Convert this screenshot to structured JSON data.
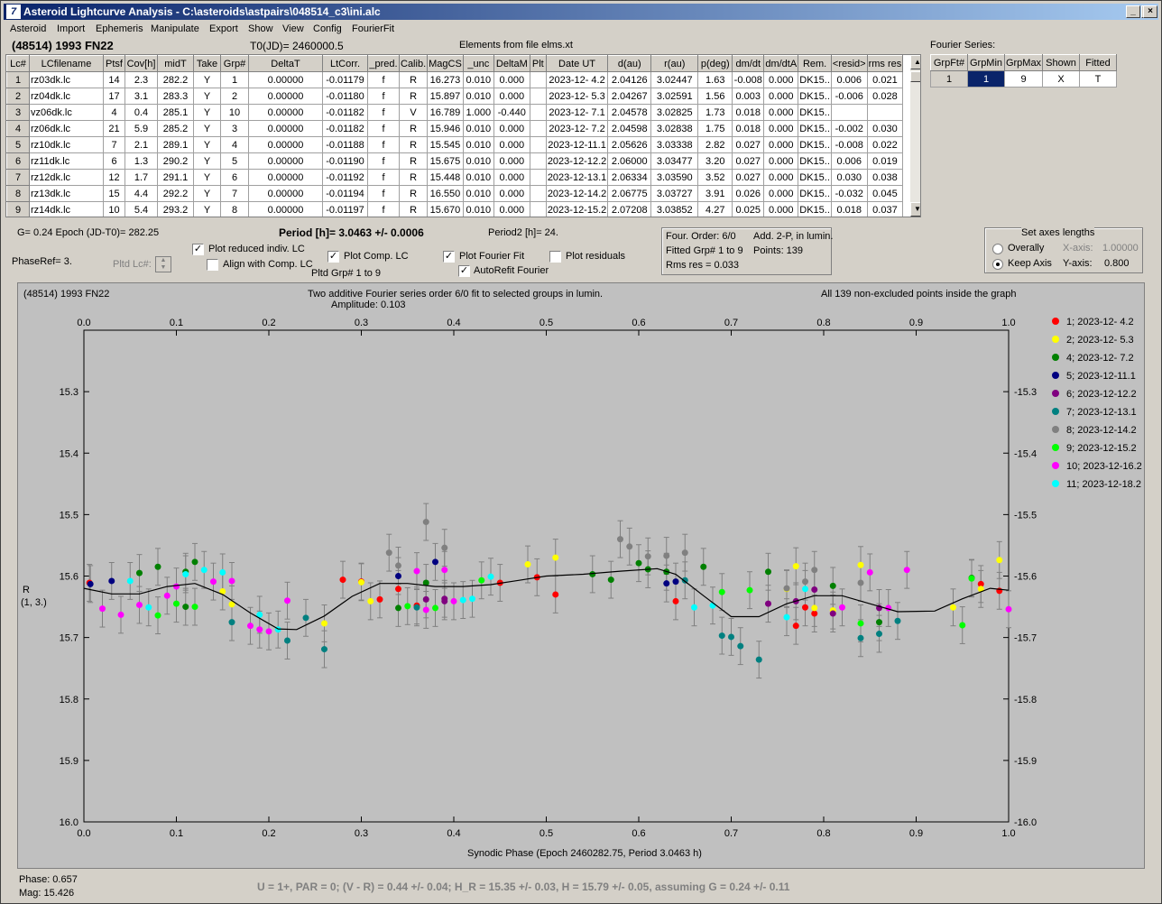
{
  "window": {
    "title": "Asteroid Lightcurve Analysis - C:\\asteroids\\astpairs\\048514_c3\\ini.alc",
    "icon_label": "7"
  },
  "menu": [
    "Asteroid",
    "Import",
    "Ephemeris",
    "Manipulate",
    "Export",
    "Show",
    "View",
    "Config",
    "FourierFit"
  ],
  "header": {
    "object": "(48514) 1993 FN22",
    "t0": "T0(JD)= 2460000.5",
    "elements": "Elements from file elms.xt",
    "fourier_title": "Fourier Series:"
  },
  "table": {
    "columns": [
      "Lc#",
      "LCfilename",
      "Ptsf",
      "Cov[h]",
      "midT",
      "Take",
      "Grp#",
      "DeltaT",
      "LtCorr.",
      "_pred.",
      "Calib.",
      "MagCS",
      "_unc",
      "DeltaM",
      "Plt",
      "Date UT",
      "d(au)",
      "r(au)",
      "p(deg)",
      "dm/dt",
      "dm/dtA",
      "Rem.",
      "<resid>",
      "rms res"
    ],
    "rows": [
      [
        "1",
        "rz03dk.lc",
        "14",
        "2.3",
        "282.2",
        "Y",
        "1",
        "0.00000",
        "-0.01179",
        "f",
        "R",
        "16.273",
        "0.010",
        "0.000",
        "",
        "2023-12- 4.2",
        "2.04126",
        "3.02447",
        "1.63",
        "-0.008",
        "0.000",
        "DK15..",
        "0.006",
        "0.021"
      ],
      [
        "2",
        "rz04dk.lc",
        "17",
        "3.1",
        "283.3",
        "Y",
        "2",
        "0.00000",
        "-0.01180",
        "f",
        "R",
        "15.897",
        "0.010",
        "0.000",
        "",
        "2023-12- 5.3",
        "2.04267",
        "3.02591",
        "1.56",
        "0.003",
        "0.000",
        "DK15..",
        "-0.006",
        "0.028"
      ],
      [
        "3",
        "vz06dk.lc",
        "4",
        "0.4",
        "285.1",
        "Y",
        "10",
        "0.00000",
        "-0.01182",
        "f",
        "V",
        "16.789",
        "1.000",
        "-0.440",
        "",
        "2023-12- 7.1",
        "2.04578",
        "3.02825",
        "1.73",
        "0.018",
        "0.000",
        "DK15..",
        "",
        ""
      ],
      [
        "4",
        "rz06dk.lc",
        "21",
        "5.9",
        "285.2",
        "Y",
        "3",
        "0.00000",
        "-0.01182",
        "f",
        "R",
        "15.946",
        "0.010",
        "0.000",
        "",
        "2023-12- 7.2",
        "2.04598",
        "3.02838",
        "1.75",
        "0.018",
        "0.000",
        "DK15..",
        "-0.002",
        "0.030"
      ],
      [
        "5",
        "rz10dk.lc",
        "7",
        "2.1",
        "289.1",
        "Y",
        "4",
        "0.00000",
        "-0.01188",
        "f",
        "R",
        "15.545",
        "0.010",
        "0.000",
        "",
        "2023-12-11.1",
        "2.05626",
        "3.03338",
        "2.82",
        "0.027",
        "0.000",
        "DK15..",
        "-0.008",
        "0.022"
      ],
      [
        "6",
        "rz11dk.lc",
        "6",
        "1.3",
        "290.2",
        "Y",
        "5",
        "0.00000",
        "-0.01190",
        "f",
        "R",
        "15.675",
        "0.010",
        "0.000",
        "",
        "2023-12-12.2",
        "2.06000",
        "3.03477",
        "3.20",
        "0.027",
        "0.000",
        "DK15..",
        "0.006",
        "0.019"
      ],
      [
        "7",
        "rz12dk.lc",
        "12",
        "1.7",
        "291.1",
        "Y",
        "6",
        "0.00000",
        "-0.01192",
        "f",
        "R",
        "15.448",
        "0.010",
        "0.000",
        "",
        "2023-12-13.1",
        "2.06334",
        "3.03590",
        "3.52",
        "0.027",
        "0.000",
        "DK15..",
        "0.030",
        "0.038"
      ],
      [
        "8",
        "rz13dk.lc",
        "15",
        "4.4",
        "292.2",
        "Y",
        "7",
        "0.00000",
        "-0.01194",
        "f",
        "R",
        "16.550",
        "0.010",
        "0.000",
        "",
        "2023-12-14.2",
        "2.06775",
        "3.03727",
        "3.91",
        "0.026",
        "0.000",
        "DK15..",
        "-0.032",
        "0.045"
      ],
      [
        "9",
        "rz14dk.lc",
        "10",
        "5.4",
        "293.2",
        "Y",
        "8",
        "0.00000",
        "-0.01197",
        "f",
        "R",
        "15.670",
        "0.010",
        "0.000",
        "",
        "2023-12-15.2",
        "2.07208",
        "3.03852",
        "4.27",
        "0.025",
        "0.000",
        "DK15..",
        "0.018",
        "0.037"
      ]
    ]
  },
  "fourier_table": {
    "columns": [
      "GrpFt#",
      "GrpMin",
      "GrpMax",
      "Shown",
      "Fitted"
    ],
    "row": [
      "1",
      "1",
      "9",
      "X",
      "T"
    ]
  },
  "controls": {
    "g_epoch": "G= 0.24   Epoch (JD-T0)= 282.25",
    "period": "Period [h]= 3.0463 +/- 0.0006",
    "period2": "Period2 [h]= 24.",
    "phaseref": "PhaseRef= 3.",
    "pltd_lc": "Pltd Lc#:",
    "plot_reduced": "Plot reduced indiv. LC",
    "align_comp": "Align with Comp. LC",
    "plot_comp": "Plot Comp. LC",
    "pltd_grp": "Pltd Grp#  1   to   9",
    "plot_fourier": "Plot Fourier Fit",
    "autorefit": "AutoRefit Fourier",
    "plot_residuals": "Plot residuals",
    "four_order": "Four. Order:  6/0",
    "add2p": "Add. 2-P, in lumin.",
    "fitted_grp": "Fitted Grp# 1 to 9",
    "points": "Points: 139",
    "rms": "Rms res     = 0.033",
    "axes_title": "Set axes lengths",
    "overally": "Overally",
    "keep_axis": "Keep Axis",
    "xaxis_lbl": "X-axis:",
    "xaxis_val": "1.00000",
    "yaxis_lbl": "Y-axis:",
    "yaxis_val": "0.800"
  },
  "plot": {
    "name": "(48514) 1993 FN22",
    "subtitle1": "Two additive Fourier series order 6/0 fit to selected groups in lumin.",
    "subtitle2": "Amplitude: 0.103",
    "note": "All 139 non-excluded points inside the graph",
    "ylabel1": "R",
    "ylabel2": "(1, 3.)"
  },
  "chart_data": {
    "type": "scatter",
    "xlabel": "Synodic Phase (Epoch 2460282.75, Period 3.0463 h)",
    "ylabel": "R (1, 3.)",
    "xlim": [
      0,
      1
    ],
    "ylim": [
      16.0,
      15.2
    ],
    "xticks": [
      "0.0",
      "0.1",
      "0.2",
      "0.3",
      "0.4",
      "0.5",
      "0.6",
      "0.7",
      "0.8",
      "0.9",
      "1.0"
    ],
    "yticks": [
      "15.3",
      "15.4",
      "15.5",
      "15.6",
      "15.7",
      "15.8",
      "15.9",
      "16.0"
    ],
    "fit_curve": [
      [
        0.0,
        15.62
      ],
      [
        0.03,
        15.629
      ],
      [
        0.06,
        15.629
      ],
      [
        0.09,
        15.617
      ],
      [
        0.12,
        15.612
      ],
      [
        0.15,
        15.63
      ],
      [
        0.18,
        15.66
      ],
      [
        0.21,
        15.686
      ],
      [
        0.23,
        15.687
      ],
      [
        0.26,
        15.665
      ],
      [
        0.29,
        15.633
      ],
      [
        0.32,
        15.612
      ],
      [
        0.35,
        15.612
      ],
      [
        0.38,
        15.617
      ],
      [
        0.41,
        15.617
      ],
      [
        0.44,
        15.614
      ],
      [
        0.47,
        15.607
      ],
      [
        0.5,
        15.6
      ],
      [
        0.54,
        15.597
      ],
      [
        0.58,
        15.592
      ],
      [
        0.62,
        15.588
      ],
      [
        0.64,
        15.597
      ],
      [
        0.67,
        15.632
      ],
      [
        0.7,
        15.666
      ],
      [
        0.73,
        15.666
      ],
      [
        0.76,
        15.645
      ],
      [
        0.79,
        15.632
      ],
      [
        0.82,
        15.632
      ],
      [
        0.85,
        15.645
      ],
      [
        0.88,
        15.658
      ],
      [
        0.92,
        15.657
      ],
      [
        0.95,
        15.637
      ],
      [
        0.98,
        15.62
      ],
      [
        1.0,
        15.623
      ]
    ],
    "series": [
      {
        "name": "1; 2023-12- 4.2",
        "color": "#ff0000",
        "points": [
          [
            0.006,
            15.611
          ],
          [
            0.28,
            15.606
          ],
          [
            0.3,
            15.609
          ],
          [
            0.32,
            15.638
          ],
          [
            0.34,
            15.621
          ],
          [
            0.36,
            15.648
          ],
          [
            0.45,
            15.611
          ],
          [
            0.49,
            15.602
          ],
          [
            0.51,
            15.63
          ],
          [
            0.64,
            15.641
          ],
          [
            0.77,
            15.681
          ],
          [
            0.78,
            15.651
          ],
          [
            0.79,
            15.661
          ],
          [
            0.97,
            15.613
          ],
          [
            0.99,
            15.624
          ]
        ]
      },
      {
        "name": "2; 2023-12- 5.3",
        "color": "#ffff00",
        "points": [
          [
            0.15,
            15.625
          ],
          [
            0.16,
            15.646
          ],
          [
            0.26,
            15.677
          ],
          [
            0.3,
            15.61
          ],
          [
            0.31,
            15.641
          ],
          [
            0.48,
            15.581
          ],
          [
            0.51,
            15.57
          ],
          [
            0.76,
            15.621
          ],
          [
            0.77,
            15.584
          ],
          [
            0.79,
            15.652
          ],
          [
            0.81,
            15.656
          ],
          [
            0.84,
            15.582
          ],
          [
            0.94,
            15.651
          ],
          [
            0.97,
            15.621
          ],
          [
            0.99,
            15.574
          ]
        ]
      },
      {
        "name": "4; 2023-12- 7.2",
        "color": "#008000",
        "points": [
          [
            0.06,
            15.595
          ],
          [
            0.08,
            15.585
          ],
          [
            0.11,
            15.593
          ],
          [
            0.12,
            15.577
          ],
          [
            0.11,
            15.65
          ],
          [
            0.34,
            15.652
          ],
          [
            0.37,
            15.611
          ],
          [
            0.55,
            15.597
          ],
          [
            0.57,
            15.606
          ],
          [
            0.6,
            15.579
          ],
          [
            0.61,
            15.589
          ],
          [
            0.63,
            15.593
          ],
          [
            0.67,
            15.585
          ],
          [
            0.74,
            15.593
          ],
          [
            0.81,
            15.616
          ],
          [
            0.86,
            15.675
          ],
          [
            0.96,
            15.603
          ]
        ]
      },
      {
        "name": "5; 2023-12-11.1",
        "color": "#000080",
        "points": [
          [
            0.007,
            15.613
          ],
          [
            0.03,
            15.608
          ],
          [
            0.34,
            15.6
          ],
          [
            0.38,
            15.577
          ],
          [
            0.63,
            15.612
          ],
          [
            0.64,
            15.609
          ]
        ]
      },
      {
        "name": "6; 2023-12-12.2",
        "color": "#800080",
        "points": [
          [
            0.37,
            15.638
          ],
          [
            0.39,
            15.637
          ],
          [
            0.39,
            15.641
          ],
          [
            0.74,
            15.645
          ],
          [
            0.77,
            15.641
          ],
          [
            0.79,
            15.622
          ],
          [
            0.81,
            15.661
          ],
          [
            0.86,
            15.652
          ]
        ]
      },
      {
        "name": "7; 2023-12-13.1",
        "color": "#008080",
        "points": [
          [
            0.16,
            15.675
          ],
          [
            0.22,
            15.705
          ],
          [
            0.24,
            15.668
          ],
          [
            0.26,
            15.719
          ],
          [
            0.36,
            15.651
          ],
          [
            0.65,
            15.607
          ],
          [
            0.69,
            15.697
          ],
          [
            0.7,
            15.699
          ],
          [
            0.71,
            15.714
          ],
          [
            0.73,
            15.736
          ],
          [
            0.84,
            15.701
          ],
          [
            0.86,
            15.694
          ],
          [
            0.88,
            15.673
          ]
        ]
      },
      {
        "name": "8; 2023-12-14.2",
        "color": "#808080",
        "points": [
          [
            0.33,
            15.562
          ],
          [
            0.34,
            15.583
          ],
          [
            0.37,
            15.512
          ],
          [
            0.39,
            15.554
          ],
          [
            0.58,
            15.54
          ],
          [
            0.59,
            15.552
          ],
          [
            0.61,
            15.568
          ],
          [
            0.63,
            15.567
          ],
          [
            0.65,
            15.562
          ],
          [
            0.76,
            15.62
          ],
          [
            0.78,
            15.609
          ],
          [
            0.79,
            15.59
          ],
          [
            0.84,
            15.611
          ]
        ]
      },
      {
        "name": "9; 2023-12-15.2",
        "color": "#00ff00",
        "points": [
          [
            0.08,
            15.664
          ],
          [
            0.1,
            15.645
          ],
          [
            0.12,
            15.65
          ],
          [
            0.35,
            15.649
          ],
          [
            0.38,
            15.652
          ],
          [
            0.43,
            15.607
          ],
          [
            0.69,
            15.626
          ],
          [
            0.72,
            15.623
          ],
          [
            0.84,
            15.677
          ],
          [
            0.95,
            15.68
          ],
          [
            0.96,
            15.604
          ]
        ]
      },
      {
        "name": "10; 2023-12-16.2",
        "color": "#ff00ff",
        "points": [
          [
            0.02,
            15.653
          ],
          [
            0.04,
            15.663
          ],
          [
            0.06,
            15.647
          ],
          [
            0.09,
            15.632
          ],
          [
            0.1,
            15.617
          ],
          [
            0.14,
            15.609
          ],
          [
            0.16,
            15.608
          ],
          [
            0.18,
            15.681
          ],
          [
            0.19,
            15.687
          ],
          [
            0.2,
            15.69
          ],
          [
            0.22,
            15.64
          ],
          [
            0.36,
            15.592
          ],
          [
            0.37,
            15.655
          ],
          [
            0.39,
            15.59
          ],
          [
            0.4,
            15.641
          ],
          [
            0.82,
            15.651
          ],
          [
            0.85,
            15.594
          ],
          [
            0.87,
            15.652
          ],
          [
            0.89,
            15.59
          ],
          [
            1.0,
            15.654
          ]
        ]
      },
      {
        "name": "11; 2023-12-18.2",
        "color": "#00ffff",
        "points": [
          [
            0.05,
            15.608
          ],
          [
            0.07,
            15.651
          ],
          [
            0.11,
            15.597
          ],
          [
            0.13,
            15.59
          ],
          [
            0.15,
            15.594
          ],
          [
            0.19,
            15.663
          ],
          [
            0.21,
            15.687
          ],
          [
            0.41,
            15.639
          ],
          [
            0.42,
            15.637
          ],
          [
            0.44,
            15.601
          ],
          [
            0.66,
            15.651
          ],
          [
            0.68,
            15.648
          ],
          [
            0.76,
            15.667
          ],
          [
            0.78,
            15.621
          ]
        ]
      }
    ]
  },
  "status": {
    "phase": "Phase:  0.657",
    "mag": "Mag:    15.426",
    "bottom": "U = 1+, PAR = 0; (V - R) = 0.44 +/- 0.04; H_R = 15.35 +/- 0.03, H = 15.79 +/- 0.05, assuming G = 0.24 +/- 0.11"
  }
}
